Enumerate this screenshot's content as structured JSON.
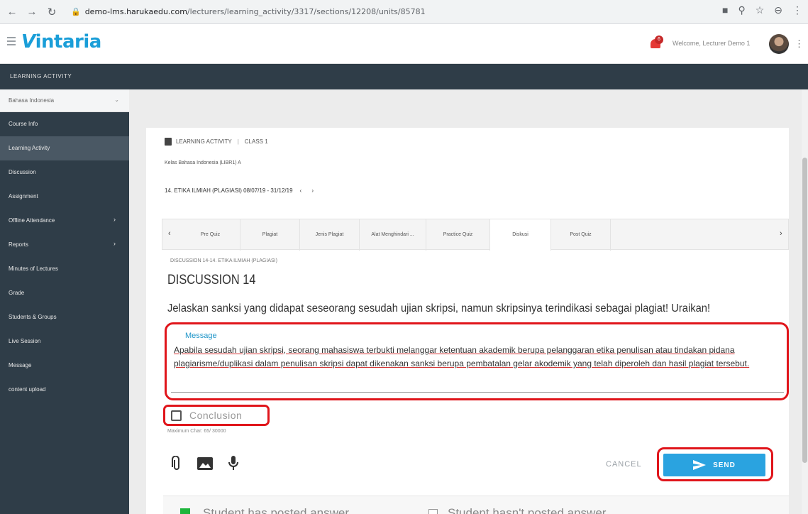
{
  "browser": {
    "url_domain": "demo-lms.harukaedu.com",
    "url_path": "/lecturers/learning_activity/3317/sections/12208/units/85781"
  },
  "header": {
    "logo": "intaria",
    "logo_mark": "V",
    "notification_count": "6",
    "welcome": "Welcome, Lecturer Demo 1"
  },
  "breadcrumb": "LEARNING ACTIVITY",
  "sidebar": {
    "course": "Bahasa Indonesia",
    "items": [
      {
        "label": "Course Info",
        "arrow": ""
      },
      {
        "label": "Learning Activity",
        "arrow": ""
      },
      {
        "label": "Discussion",
        "arrow": ""
      },
      {
        "label": "Assignment",
        "arrow": ""
      },
      {
        "label": "Offline Attendance",
        "arrow": "›"
      },
      {
        "label": "Reports",
        "arrow": "›"
      },
      {
        "label": "Minutes of Lectures",
        "arrow": ""
      },
      {
        "label": "Grade",
        "arrow": ""
      },
      {
        "label": "Students & Groups",
        "arrow": ""
      },
      {
        "label": "Live Session",
        "arrow": ""
      },
      {
        "label": "Message",
        "arrow": ""
      },
      {
        "label": "content upload",
        "arrow": ""
      }
    ]
  },
  "activity": {
    "header_label": "LEARNING ACTIVITY",
    "class_label": "CLASS 1",
    "kelas": "Kelas Bahasa Indonesia (LIBR1) A",
    "topic": "14. ETIKA ILMIAH (PLAGIASI) 08/07/19 - 31/12/19",
    "nav_arrows": "‹ ›"
  },
  "tabs": [
    "Pre Quiz",
    "Plagiat",
    "Jenis Plagiat",
    "Alat Menghindari ...",
    "Practice Quiz",
    "Diskusi",
    "Post Quiz"
  ],
  "discussion": {
    "crumb": "DISCUSSION 14-14. ETIKA ILMIAH (PLAGIASI)",
    "title": "DISCUSSION 14",
    "question": "Jelaskan sanksi yang didapat seseorang sesudah ujian skripsi, namun skripsinya terindikasi sebagai plagiat! Uraikan!",
    "message_label": "Message",
    "message_text": "Apabila sesudah ujian skripsi, seorang mahasiswa terbukti melanggar ketentuan akademik berupa pelanggaran etika penulisan atau tindakan pidana plagiarisme/duplikasi dalam penulisan skripsi dapat dikenakan sanksi berupa pembatalan gelar akodemik yang telah diperoleh dan hasil plagiat tersebut.",
    "conclusion_label": "Conclusion",
    "max_chars": "Maximum Char: 65/ 30000",
    "cancel_label": "CANCEL",
    "send_label": "SEND"
  },
  "legend": {
    "posted": "Student has posted answer",
    "not_posted": "Student hasn't posted answer"
  },
  "colors": {
    "brand": "#1a9ed8",
    "sidebar": "#2f3d48",
    "highlight": "#e0151b",
    "send": "#2aa3e0",
    "posted": "#1db53b"
  }
}
